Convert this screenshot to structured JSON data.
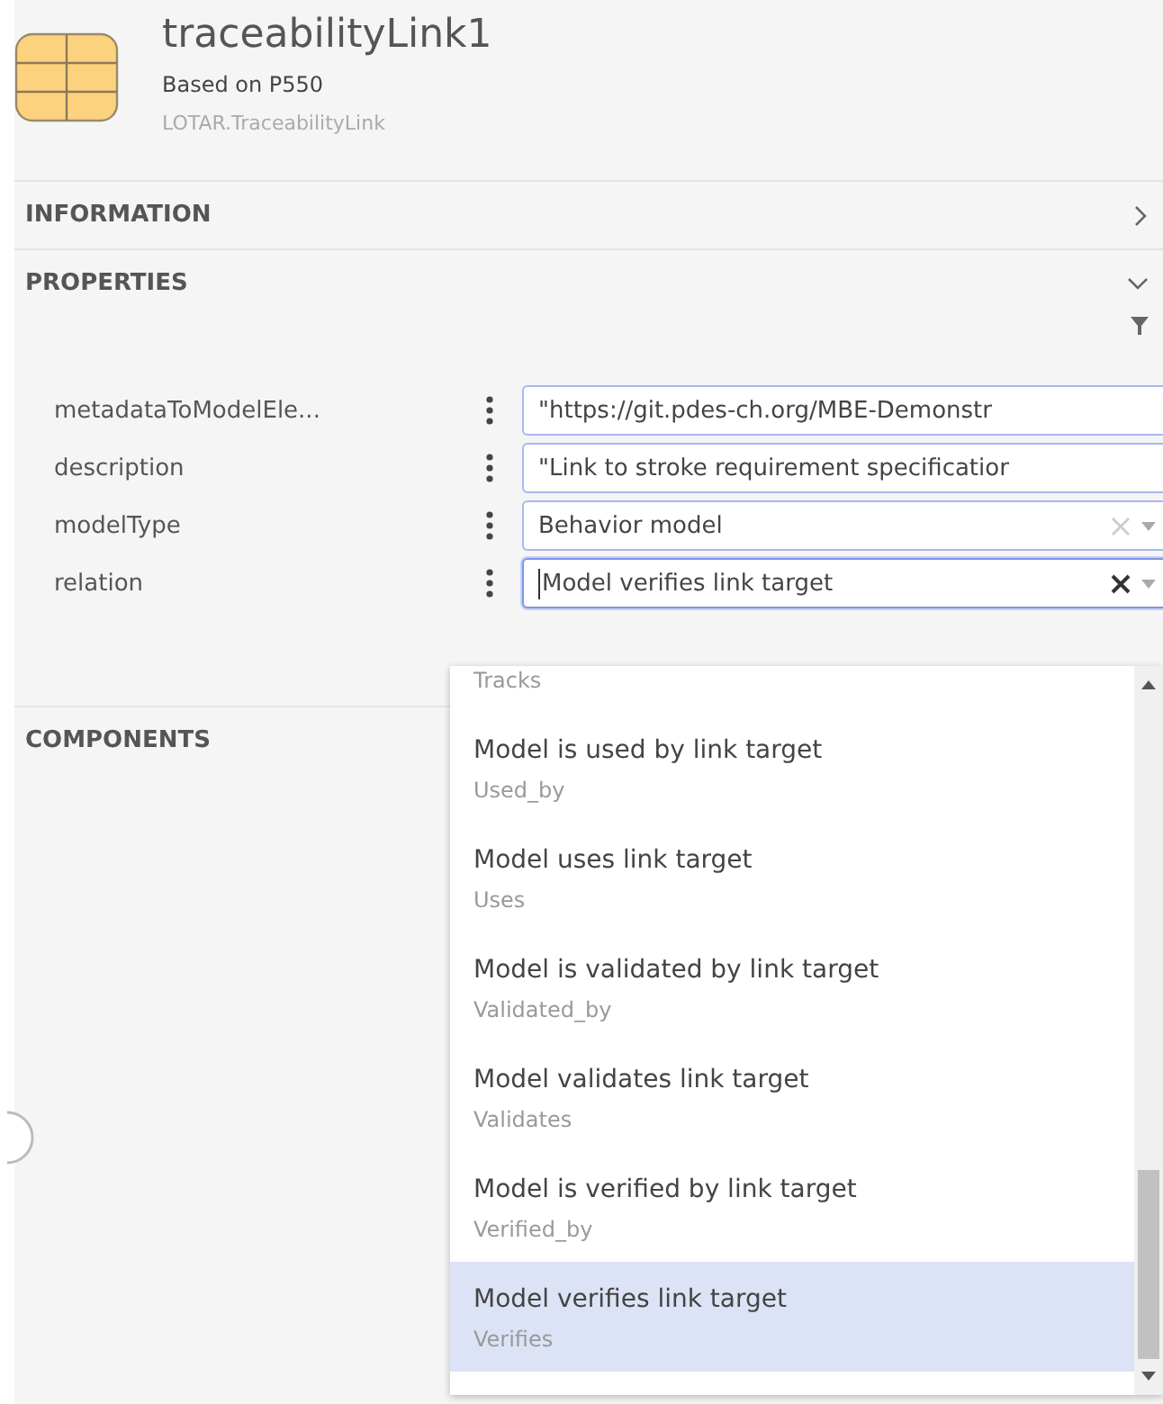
{
  "header": {
    "title": "traceabilityLink1",
    "subtitle": "Based on P550",
    "type": "LOTAR.TraceabilityLink"
  },
  "sections": [
    {
      "title": "INFORMATION",
      "expanded": false
    },
    {
      "title": "PROPERTIES",
      "expanded": true
    }
  ],
  "properties": [
    {
      "name": "metadataToModelEle...",
      "kind": "text",
      "value": "\"https://git.pdes-ch.org/MBE-Demonstr",
      "focused": false
    },
    {
      "name": "description",
      "kind": "text",
      "value": "\"Link to stroke requirement specificatior",
      "focused": false
    },
    {
      "name": "modelType",
      "kind": "select",
      "value": "Behavior model",
      "focused": false
    },
    {
      "name": "relation",
      "kind": "select",
      "value": "Model verifies link target",
      "focused": true
    }
  ],
  "components": {
    "title": "COMPONENTS"
  },
  "dropdown": {
    "options": [
      {
        "value": "Tracks",
        "selected": false
      },
      {
        "label": "Model is used by link target",
        "value": "Used_by",
        "selected": false
      },
      {
        "label": "Model uses link target",
        "value": "Uses",
        "selected": false
      },
      {
        "label": "Model is validated by link target",
        "value": "Validated_by",
        "selected": false
      },
      {
        "label": "Model validates link target",
        "value": "Validates",
        "selected": false
      },
      {
        "label": "Model is verified by link target",
        "value": "Verified_by",
        "selected": false
      },
      {
        "label": "Model verifies link target",
        "value": "Verifies",
        "selected": true
      }
    ]
  }
}
